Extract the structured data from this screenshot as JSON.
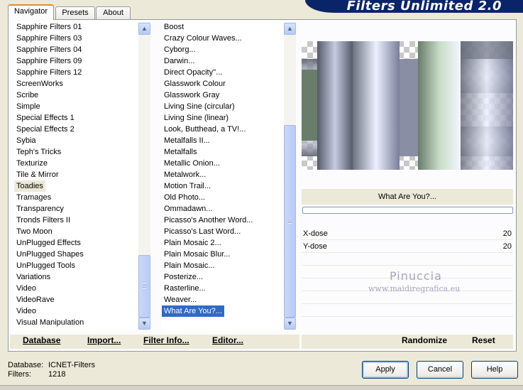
{
  "app": {
    "title": "Filters Unlimited 2.0"
  },
  "tabs": [
    {
      "label": "Navigator",
      "active": true
    },
    {
      "label": "Presets",
      "active": false
    },
    {
      "label": "About",
      "active": false
    }
  ],
  "categories": {
    "items": [
      "Sapphire Filters 01",
      "Sapphire Filters 03",
      "Sapphire Filters 04",
      "Sapphire Filters 09",
      "Sapphire Filters 12",
      "ScreenWorks",
      "Scribe",
      "Simple",
      "Special Effects 1",
      "Special Effects 2",
      "Sybia",
      "Teph's Tricks",
      "Texturize",
      "Tile & Mirror",
      "Toadies",
      "Tramages",
      "Transparency",
      "Tronds Filters II",
      "Two Moon",
      "UnPlugged Effects",
      "UnPlugged Shapes",
      "UnPlugged Tools",
      "Variations",
      "Video",
      "VideoRave",
      "Video",
      "Visual Manipulation"
    ],
    "selected": "Toadies"
  },
  "filters": {
    "items": [
      "Boost",
      "Crazy Colour Waves...",
      "Cyborg...",
      "Darwin...",
      "Direct Opacity''...",
      "Glasswork Colour",
      "Glasswork Gray",
      "Living Sine (circular)",
      "Living Sine (linear)",
      "Look, Butthead, a TV!...",
      "Metalfalls II...",
      "Metalfalls",
      "Metallic Onion...",
      "Metalwork...",
      "Motion Trail...",
      "Old Photo...",
      "Ommadawn...",
      "Picasso's Another Word...",
      "Picasso's Last Word...",
      "Plain Mosaic 2...",
      "Plain Mosaic Blur...",
      "Plain Mosaic...",
      "Posterize...",
      "Rasterline...",
      "Weaver...",
      "What Are You?..."
    ],
    "selected": "What Are You?..."
  },
  "preview": {
    "filter_name": "What Are You?...",
    "progress": 0
  },
  "params": [
    {
      "label": "X-dose",
      "value": "20"
    },
    {
      "label": "Y-dose",
      "value": "20"
    }
  ],
  "watermark": {
    "name": "Pinuccia",
    "url": "www.maidiregrafica.eu"
  },
  "links": {
    "database": "Database",
    "import": "Import...",
    "filter_info": "Filter Info...",
    "editor": "Editor...",
    "randomize": "Randomize",
    "reset": "Reset"
  },
  "status": {
    "database_label": "Database:",
    "database_value": "ICNET-Filters",
    "filters_label": "Filters:",
    "filters_value": "1218"
  },
  "buttons": {
    "apply": "Apply",
    "cancel": "Cancel",
    "help": "Help"
  },
  "colors": {
    "accent": "#316ac5",
    "title_bar": "#0a246a",
    "tab_highlight": "#e68b2c"
  }
}
